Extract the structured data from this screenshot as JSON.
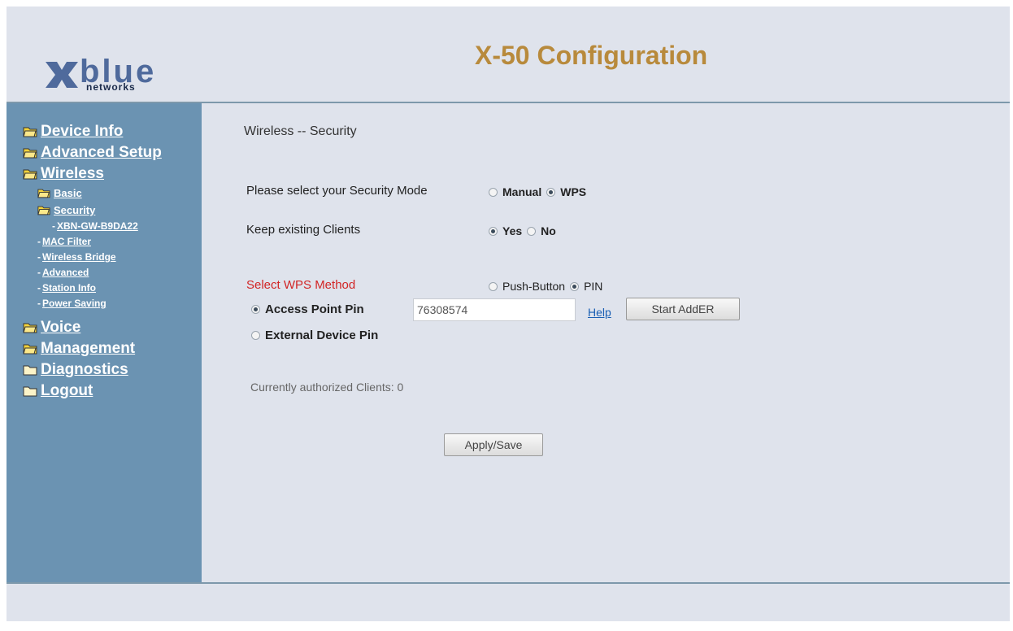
{
  "header": {
    "logo_text": "blue",
    "logo_sub": "networks",
    "title": "X-50 Configuration"
  },
  "sidebar": {
    "items": [
      {
        "label": "Device Info",
        "level": 1
      },
      {
        "label": "Advanced Setup",
        "level": 1
      },
      {
        "label": "Wireless",
        "level": 1
      },
      {
        "label": "Basic",
        "level": 2
      },
      {
        "label": "Security",
        "level": 2
      },
      {
        "label": "XBN-GW-B9DA22",
        "level": 3
      },
      {
        "label": "MAC Filter",
        "level": 3
      },
      {
        "label": "Wireless Bridge",
        "level": 3
      },
      {
        "label": "Advanced",
        "level": 3
      },
      {
        "label": "Station Info",
        "level": 3
      },
      {
        "label": "Power Saving",
        "level": 3
      },
      {
        "label": "Voice",
        "level": 1
      },
      {
        "label": "Management",
        "level": 1
      },
      {
        "label": "Diagnostics",
        "level": 1
      },
      {
        "label": "Logout",
        "level": 1
      }
    ]
  },
  "main": {
    "section_title": "Wireless -- Security",
    "security_mode": {
      "label": "Please select your Security Mode",
      "options": [
        "Manual",
        "WPS"
      ],
      "selected": "WPS"
    },
    "keep_clients": {
      "label": "Keep existing Clients",
      "options": [
        "Yes",
        "No"
      ],
      "selected": "Yes"
    },
    "wps_method": {
      "label": "Select WPS Method",
      "options": [
        "Push-Button",
        "PIN"
      ],
      "selected": "PIN"
    },
    "access_point_pin": {
      "label": "Access Point Pin",
      "value": "76308574",
      "selected": true
    },
    "external_device_pin": {
      "label": "External Device Pin",
      "selected": false
    },
    "help_link": "Help",
    "start_button": "Start AddER",
    "authorized_clients": "Currently authorized Clients: 0",
    "apply_button": "Apply/Save"
  },
  "colors": {
    "sidebar_bg": "#6b93b2",
    "page_bg": "#dfe3ec",
    "title": "#b88a3c",
    "logo": "#4f6a9c",
    "link": "#1a5fb4",
    "wps_label": "#d22525"
  }
}
